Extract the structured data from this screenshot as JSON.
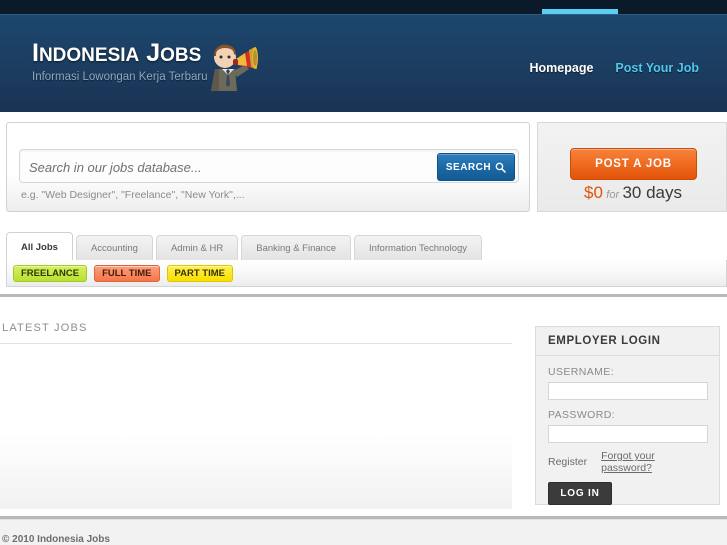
{
  "brand": {
    "name_part1": "I",
    "name_part2": "NDONESIA",
    "name_part3": " J",
    "name_part4": "OBS",
    "full_name": "Indonesia Jobs",
    "tagline": "Informasi Lowongan Kerja Terbaru",
    "mascot_icon": "megaphone-man-icon",
    "accent_color": "#5bd0f0"
  },
  "nav": {
    "items": [
      {
        "label": "Homepage",
        "active": true
      },
      {
        "label": "Post Your Job",
        "active": false
      }
    ]
  },
  "search": {
    "placeholder": "Search in our jobs database...",
    "value": "",
    "button_label": "SEARCH",
    "button_icon": "magnifier-icon",
    "hint": "e.g. \"Web Designer\", \"Freelance\", \"New York\",..."
  },
  "post_job": {
    "button_label": "POST A JOB",
    "price_amount": "$0",
    "price_for": "for",
    "price_days": "30 days",
    "accent_color": "#e2540a"
  },
  "tabs": [
    {
      "label": "All Jobs",
      "active": true
    },
    {
      "label": "Accounting",
      "active": false
    },
    {
      "label": "Admin & HR",
      "active": false
    },
    {
      "label": "Banking & Finance",
      "active": false
    },
    {
      "label": "Information Technology",
      "active": false
    }
  ],
  "filters": [
    {
      "label": "FREELANCE",
      "color": "#b9e032"
    },
    {
      "label": "FULL TIME",
      "color": "#f4764a"
    },
    {
      "label": "PART TIME",
      "color": "#f7e000"
    }
  ],
  "main": {
    "section_title": "LATEST JOBS",
    "jobs": []
  },
  "login": {
    "title": "EMPLOYER LOGIN",
    "username_label": "USERNAME:",
    "username_value": "",
    "password_label": "PASSWORD:",
    "password_value": "",
    "register_label": "Register",
    "forgot_label": "Forgot your password?",
    "submit_label": "LOG IN"
  },
  "footer": {
    "copyright": "© 2010 Indonesia Jobs"
  }
}
